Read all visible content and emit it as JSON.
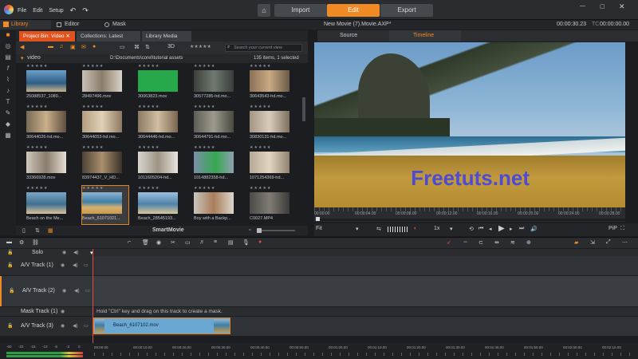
{
  "menu": {
    "file": "File",
    "edit": "Edit",
    "setup": "Setup"
  },
  "modes": {
    "import": "Import",
    "edit": "Edit",
    "export": "Export"
  },
  "timecode": "00:00:30.23",
  "timecode_prefix": "TC",
  "timecode2": "00:00:00.00",
  "tabs": {
    "library": "Library",
    "editor": "Editor",
    "mask": "Mask"
  },
  "library": {
    "tabs": [
      "Project Bin: Video",
      "Collections: Latest Imp...",
      "Library Media"
    ],
    "search_placeholder": "Search your current view",
    "folder": "video",
    "path": "D:\\Documents\\corel\\tutorial assets",
    "count": "135 items, 1 selected",
    "view_label": "3D",
    "items": [
      {
        "name": "25088537_1080..."
      },
      {
        "name": "28497496.mov"
      },
      {
        "name": "30063823.mov"
      },
      {
        "name": "30577285-hd.mo..."
      },
      {
        "name": "30643543-hd.mo..."
      },
      {
        "name": "30644026-hd.mo..."
      },
      {
        "name": "30644053-hd.mo..."
      },
      {
        "name": "30644446-hd.mo..."
      },
      {
        "name": "30644791-hd.mo..."
      },
      {
        "name": "30830131-hd.mo..."
      },
      {
        "name": "33366928.mov"
      },
      {
        "name": "83974437_V_HD..."
      },
      {
        "name": "1011605204-hd..."
      },
      {
        "name": "1014882358-hd..."
      },
      {
        "name": "1071254369-hd..."
      },
      {
        "name": "Beach on the Me..."
      },
      {
        "name": "Beach_61071021..."
      },
      {
        "name": "Beach_28545193..."
      },
      {
        "name": "Boy with a Backp..."
      },
      {
        "name": "C0027.MP4"
      }
    ],
    "smartmovie": "SmartMovie"
  },
  "preview": {
    "title": "New Movie (7).Movie.AXP*",
    "tab_source": "Source",
    "tab_timeline": "Timeline",
    "ruler": [
      "00:00:00",
      "00:00:04.00",
      "00:00:08.00",
      "00:00:12.00",
      "00:00:16.00",
      "00:00:20.00",
      "00:00:24.00",
      "00:00:28.00"
    ],
    "fit": "Fit",
    "speed": "1x",
    "pip": "PiP",
    "watermark": "Freetuts.net"
  },
  "timeline": {
    "solo": "Solo",
    "tracks": [
      {
        "name": "A/V Track (1)"
      },
      {
        "name": "A/V Track (2)"
      },
      {
        "name": "Mask Track (1)"
      },
      {
        "name": "A/V Track (3)"
      }
    ],
    "mask_hint": "Hold \"Ctrl\" key and drag on this track to create a mask.",
    "clip": "Beach_6107102.mov",
    "meter": [
      "-60",
      "-22",
      "-16",
      "-10",
      "-6",
      "-3",
      "0"
    ],
    "ruler": [
      "00:00:00",
      "00:00:10.00",
      "00:00:20.00",
      "00:00:30.00",
      "00:00:40.00",
      "00:00:50.00",
      "00:01:00.00",
      "00:01:10.00",
      "00:01:20.00",
      "00:01:30.00",
      "00:01:40.00",
      "00:01:50.00",
      "00:02:00.00",
      "00:02:10.00"
    ]
  },
  "colors": {
    "accent": "#f08a24",
    "clip": "#6aa7d3",
    "selected_tab": "#e0531f"
  }
}
